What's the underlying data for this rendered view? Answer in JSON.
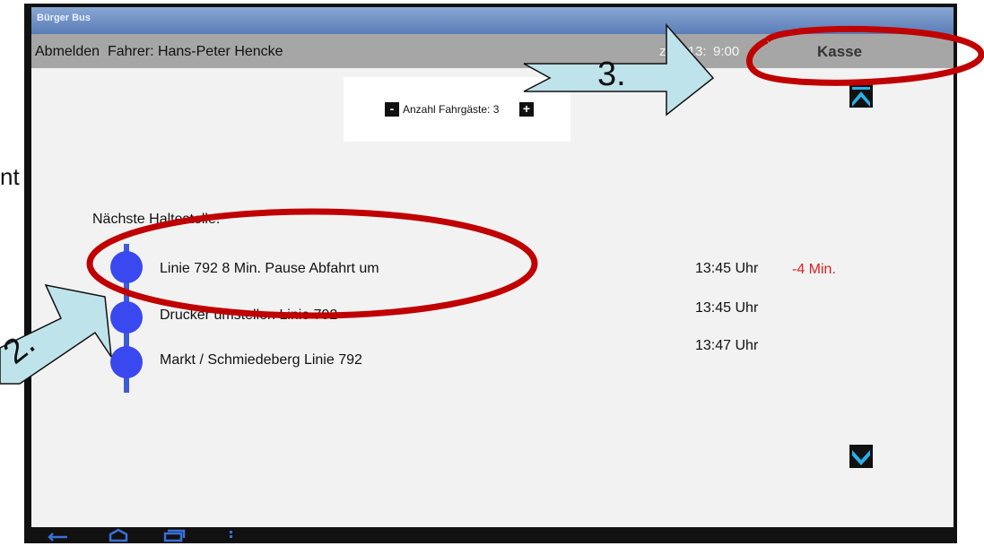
{
  "window": {
    "title": "Bürger Bus"
  },
  "header": {
    "logout_label": "Abmelden",
    "driver_label": "Fahrer: Hans-Peter Hencke",
    "clock_text": "zeit: 13:",
    "clock_suffix": "9:00",
    "register_label": "Kasse"
  },
  "passengers": {
    "minus_label": "-",
    "count_label": "Anzahl Fahrgäste: 3",
    "plus_label": "+"
  },
  "stops": {
    "section_label": "Nächste Haltestelle:",
    "items": [
      {
        "name": "Linie 792  8 Min. Pause   Abfahrt um",
        "time": "13:45 Uhr",
        "delay": "-4 Min."
      },
      {
        "name": "Drucker umstellen Linie 792",
        "time": "13:45 Uhr",
        "delay": ""
      },
      {
        "name": "Markt / Schmiedeberg Linie 792",
        "time": "13:47 Uhr",
        "delay": ""
      }
    ]
  },
  "annotations": {
    "callout_2": "2.",
    "callout_3": "3.",
    "stray_text": "nt"
  },
  "colors": {
    "accent_blue": "#3a48f0",
    "nav_arrow": "#2ab0e8",
    "delay_red": "#e02020",
    "highlight_red": "#c00000",
    "callout_fill": "#bfe3ea"
  },
  "icons": {
    "scroll_up": "chevron-up-icon",
    "scroll_down": "chevron-down-icon",
    "android_back": "back-icon",
    "android_home": "home-icon",
    "android_recent": "recent-apps-icon",
    "android_menu": "menu-icon"
  }
}
